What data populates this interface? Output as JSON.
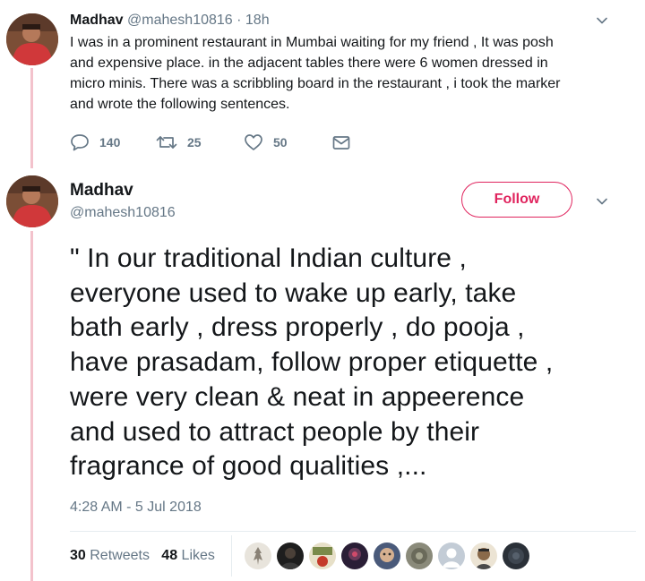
{
  "tweet1": {
    "name": "Madhav",
    "handle": "@mahesh10816",
    "separator": " · ",
    "time": "18h",
    "lines": [
      "I was in a prominent restaurant in Mumbai waiting for my friend , It was posh",
      "and expensive place. in the adjacent tables there were 6 women dressed in",
      "micro minis. There was a scribbling board in the restaurant , i took the marker",
      "and wrote the following sentences."
    ],
    "replies": "140",
    "retweets": "25",
    "likes": "50"
  },
  "tweet2": {
    "name": "Madhav",
    "handle": "@mahesh10816",
    "follow_label": "Follow",
    "lines": [
      "\" In our traditional Indian culture ,",
      "everyone used to wake up early, take",
      "bath early , dress properly , do pooja ,",
      "have prasadam, follow proper etiquette ,",
      "were very clean & neat in appeerence",
      "and used to attract people by their",
      "fragrance of good qualities ,..."
    ],
    "timestamp": "4:28 AM - 5 Jul 2018",
    "retweet_count": "30",
    "retweet_label": "Retweets",
    "like_count": "48",
    "like_label": "Likes"
  },
  "colors": {
    "accent": "#e0245e",
    "thread_line": "#f3c2cc",
    "secondary_text": "#657786",
    "primary_text": "#14171a",
    "liker_avatars": [
      "#cfc9c0",
      "#2a2a2a",
      "#7a8a4a",
      "#3a2a4a",
      "#5a6a8a",
      "#8a8a7a",
      "#aab4c0",
      "#c8b8a0",
      "#3a4048"
    ]
  },
  "icons": {
    "reply": "reply-icon",
    "retweet": "retweet-icon",
    "like": "heart-icon",
    "dm": "envelope-icon",
    "menu": "chevron-down-icon"
  }
}
